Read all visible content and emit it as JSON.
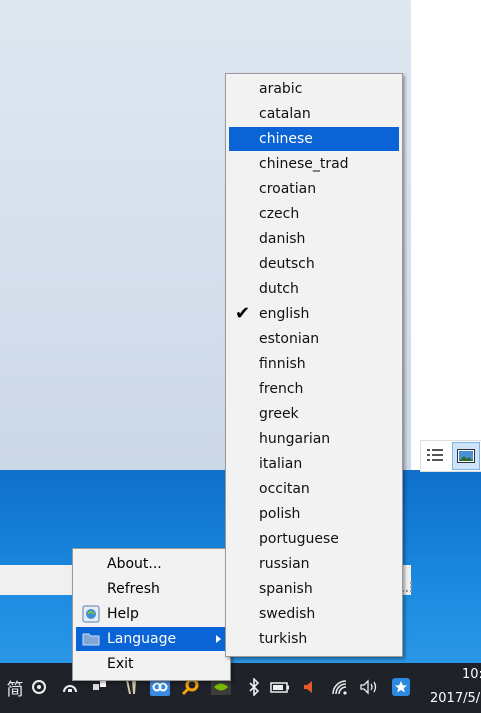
{
  "context_menu": {
    "items": [
      {
        "label": "About..."
      },
      {
        "label": "Refresh"
      },
      {
        "label": "Help",
        "icon": "help-icon"
      },
      {
        "label": "Language",
        "icon": "folder-icon",
        "has_submenu": true,
        "highlighted": true
      },
      {
        "label": "Exit"
      }
    ]
  },
  "language_menu": {
    "items": [
      {
        "label": "arabic"
      },
      {
        "label": "catalan"
      },
      {
        "label": "chinese",
        "highlighted": true
      },
      {
        "label": "chinese_trad"
      },
      {
        "label": "croatian"
      },
      {
        "label": "czech"
      },
      {
        "label": "danish"
      },
      {
        "label": "deutsch"
      },
      {
        "label": "dutch"
      },
      {
        "label": "english",
        "checked": true
      },
      {
        "label": "estonian"
      },
      {
        "label": "finnish"
      },
      {
        "label": "french"
      },
      {
        "label": "greek"
      },
      {
        "label": "hungarian"
      },
      {
        "label": "italian"
      },
      {
        "label": "occitan"
      },
      {
        "label": "polish"
      },
      {
        "label": "portuguese"
      },
      {
        "label": "russian"
      },
      {
        "label": "spanish"
      },
      {
        "label": "swedish"
      },
      {
        "label": "turkish"
      }
    ],
    "check_mark": "✔"
  },
  "taskbar": {
    "ime_indicator": "简",
    "clock_time": "10:",
    "clock_date": "2017/5/"
  },
  "colors": {
    "highlight": "#0a64d6",
    "taskbar": "#1f2229",
    "menu_bg": "#f2f2f2"
  }
}
